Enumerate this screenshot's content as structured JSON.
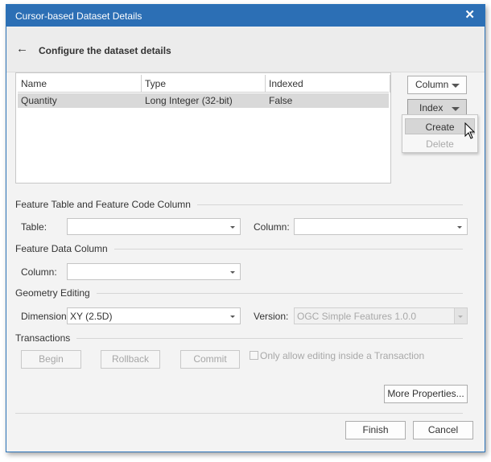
{
  "window": {
    "title": "Cursor-based Dataset Details",
    "close_glyph": "✕"
  },
  "header": {
    "back_glyph": "←",
    "heading": "Configure the dataset details"
  },
  "grid": {
    "columns": [
      "Name",
      "Type",
      "Indexed"
    ],
    "rows": [
      [
        "Quantity",
        "Long Integer (32-bit)",
        "False"
      ]
    ]
  },
  "side_buttons": {
    "column_label": "Column",
    "index_label": "Index"
  },
  "index_menu": {
    "items": [
      "Create",
      "Delete"
    ]
  },
  "feature_table": {
    "section_label": "Feature Table and Feature Code Column",
    "table_label": "Table:",
    "table_value": "",
    "column_label": "Column:",
    "column_value": ""
  },
  "feature_data": {
    "section_label": "Feature Data Column",
    "column_label": "Column:",
    "column_value": ""
  },
  "geometry": {
    "section_label": "Geometry Editing",
    "dimension_label": "Dimension:",
    "dimension_value": "XY (2.5D)",
    "version_label": "Version:",
    "version_value": "OGC Simple Features 1.0.0"
  },
  "transactions": {
    "section_label": "Transactions",
    "begin_label": "Begin",
    "rollback_label": "Rollback",
    "commit_label": "Commit",
    "only_inside_label": "Only allow editing inside a Transaction",
    "only_inside_checked": false
  },
  "footer": {
    "more_properties_label": "More Properties...",
    "finish_label": "Finish",
    "cancel_label": "Cancel"
  },
  "icons": {
    "cursor": "mouse-pointer-icon"
  }
}
